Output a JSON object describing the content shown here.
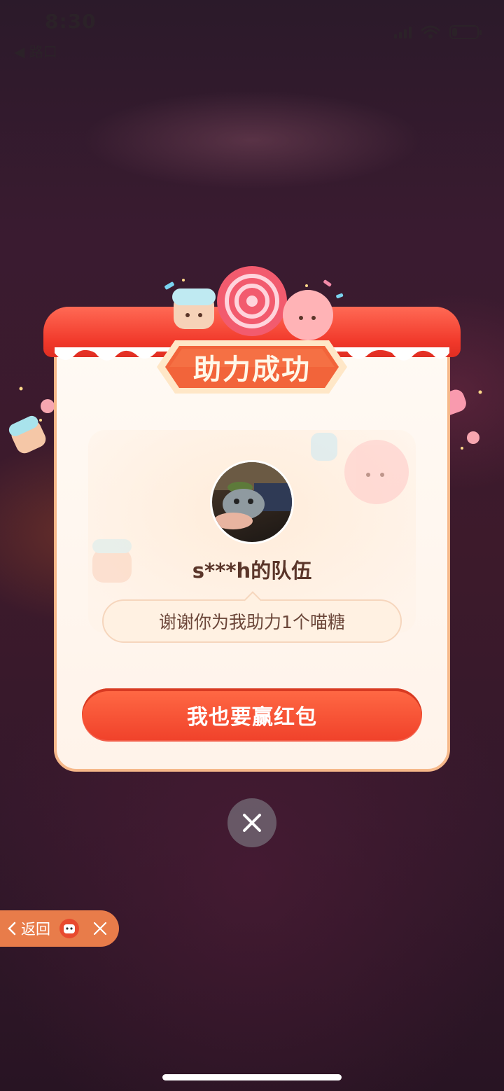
{
  "status_bar": {
    "time": "8:30",
    "back_app_label": "◀ 路口"
  },
  "dialog": {
    "title": "助力成功",
    "team_name": "s***h的队伍",
    "message": "谢谢你为我助力1个喵糖",
    "cta_label": "我也要赢红包"
  },
  "return_pill": {
    "label": "返回"
  },
  "colors": {
    "accent_red": "#f0412a",
    "title_orange": "#f26a3c",
    "card_border": "#f6b88a"
  }
}
